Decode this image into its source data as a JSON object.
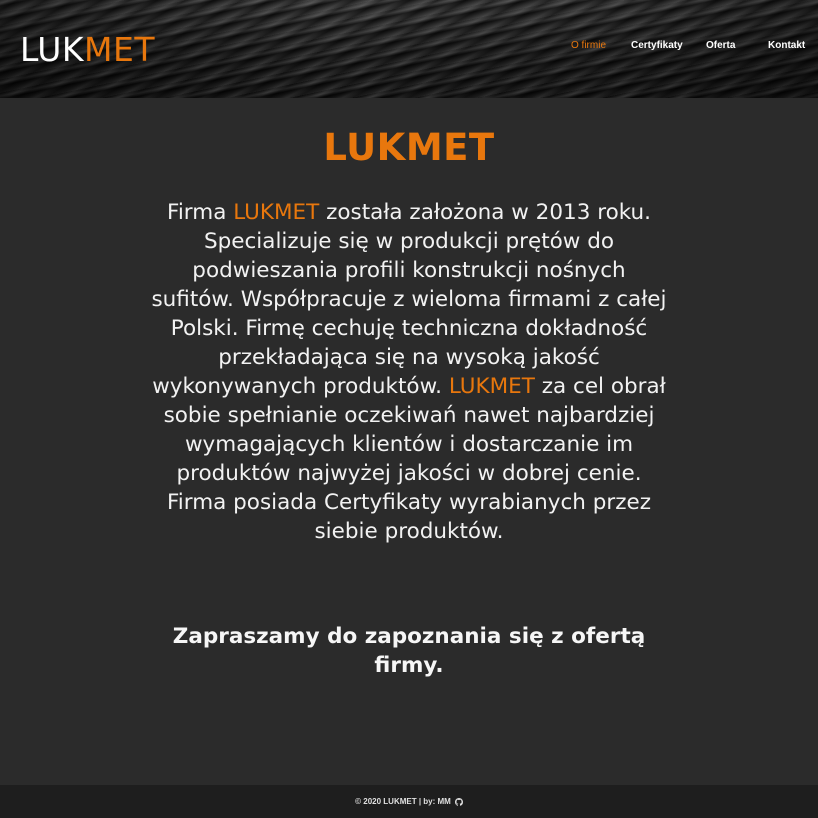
{
  "header": {
    "logo": {
      "part1": "LUK",
      "part2": "MET"
    },
    "nav": [
      {
        "label": "O firmie",
        "active": true
      },
      {
        "label": "Certyfikaty",
        "active": false
      },
      {
        "label": "Oferta",
        "active": false
      },
      {
        "label": "Kontakt",
        "active": false
      }
    ]
  },
  "main": {
    "title": "LUKMET",
    "intro": {
      "s1": "Firma ",
      "brand1": "LUKMET",
      "s2": " została założona w 2013 roku. Specializuje się w produkcji prętów do podwieszania profili konstrukcji nośnych sufitów. Współpracuje z wieloma firmami z całej Polski. Firmę cechuję techniczna dokładność przekładająca się na wysoką jakość wykonywanych produktów. ",
      "brand2": "LUKMET",
      "s3": " za cel obrał sobie spełnianie oczekiwań nawet najbardziej wymagających klientów i dostarczanie im produktów najwyżej jakości w dobrej cenie. Firma posiada Certyfikaty wyrabianych przez siebie produktów."
    },
    "invite": "Zapraszamy do zapoznania się z ofertą firmy."
  },
  "footer": {
    "text": "© 2020 LUKMET | by: MM",
    "icon": "github-icon"
  },
  "colors": {
    "accent": "#e8770d",
    "background": "#2b2b2b",
    "footer": "#1e1e1e"
  }
}
